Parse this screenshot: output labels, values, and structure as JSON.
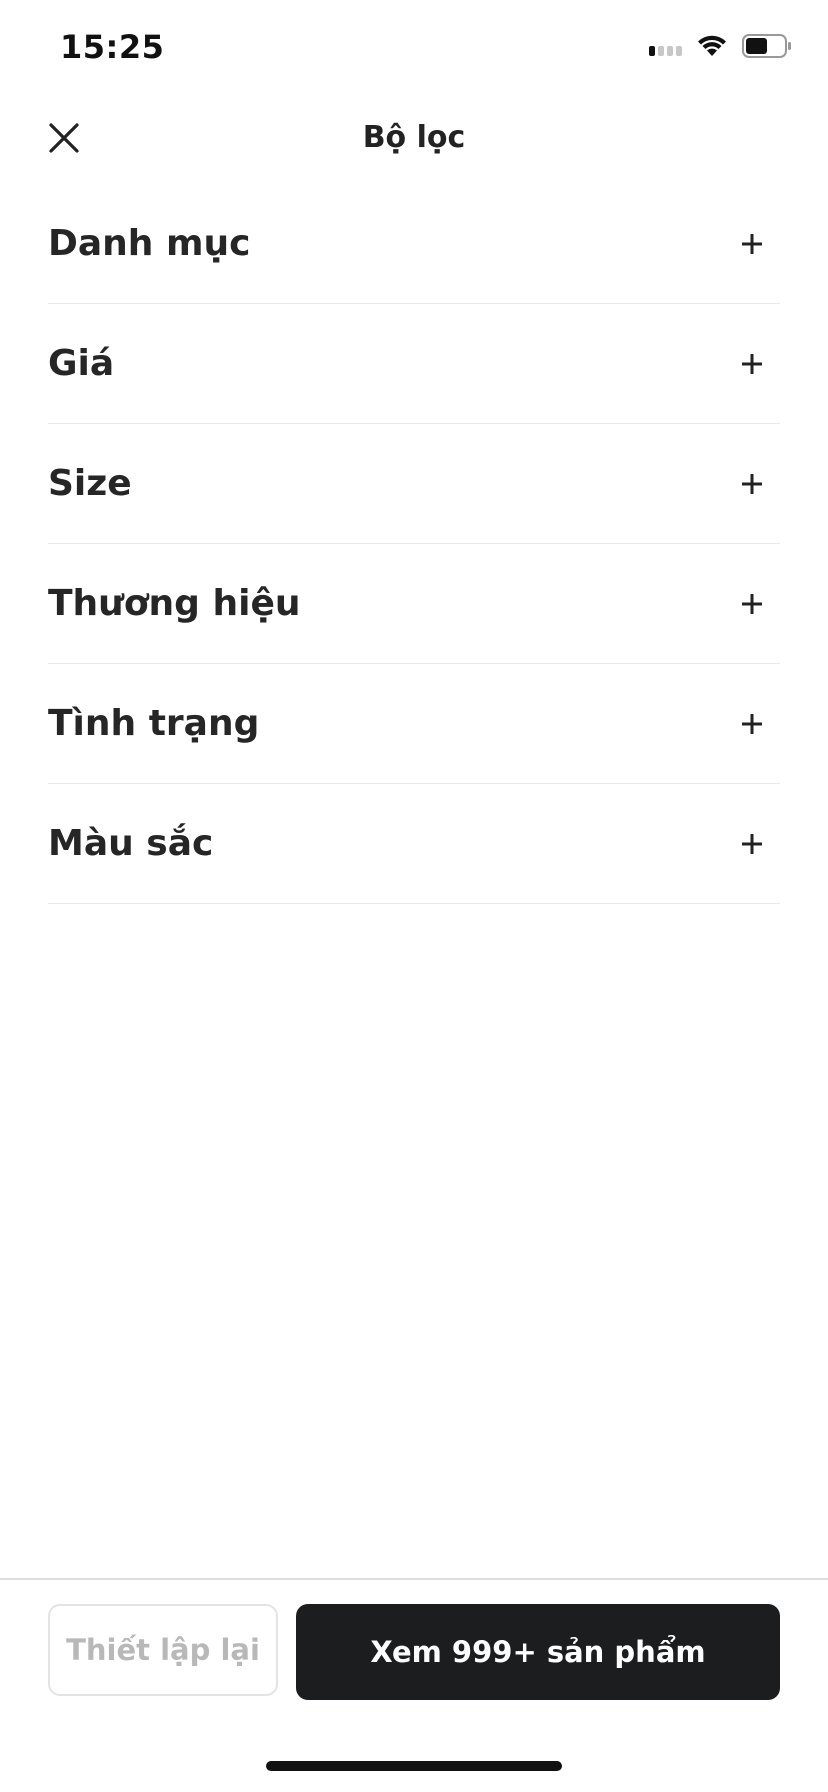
{
  "status_bar": {
    "time": "15:25",
    "icons": [
      "signal-icon",
      "wifi-icon",
      "battery-icon"
    ]
  },
  "header": {
    "title": "Bộ lọc",
    "close_icon": "close-icon"
  },
  "filters": [
    {
      "label": "Danh mục",
      "icon": "plus-icon"
    },
    {
      "label": "Giá",
      "icon": "plus-icon"
    },
    {
      "label": "Size",
      "icon": "plus-icon"
    },
    {
      "label": "Thương hiệu",
      "icon": "plus-icon"
    },
    {
      "label": "Tình trạng",
      "icon": "plus-icon"
    },
    {
      "label": "Màu sắc",
      "icon": "plus-icon"
    }
  ],
  "footer": {
    "reset_label": "Thiết lập lại",
    "view_label": "Xem 999+ sản phẩm"
  },
  "colors": {
    "primary_button": "#1c1d1f",
    "text": "#222222",
    "disabled_text": "#b8b8b8",
    "divider": "#e8e8e8"
  }
}
